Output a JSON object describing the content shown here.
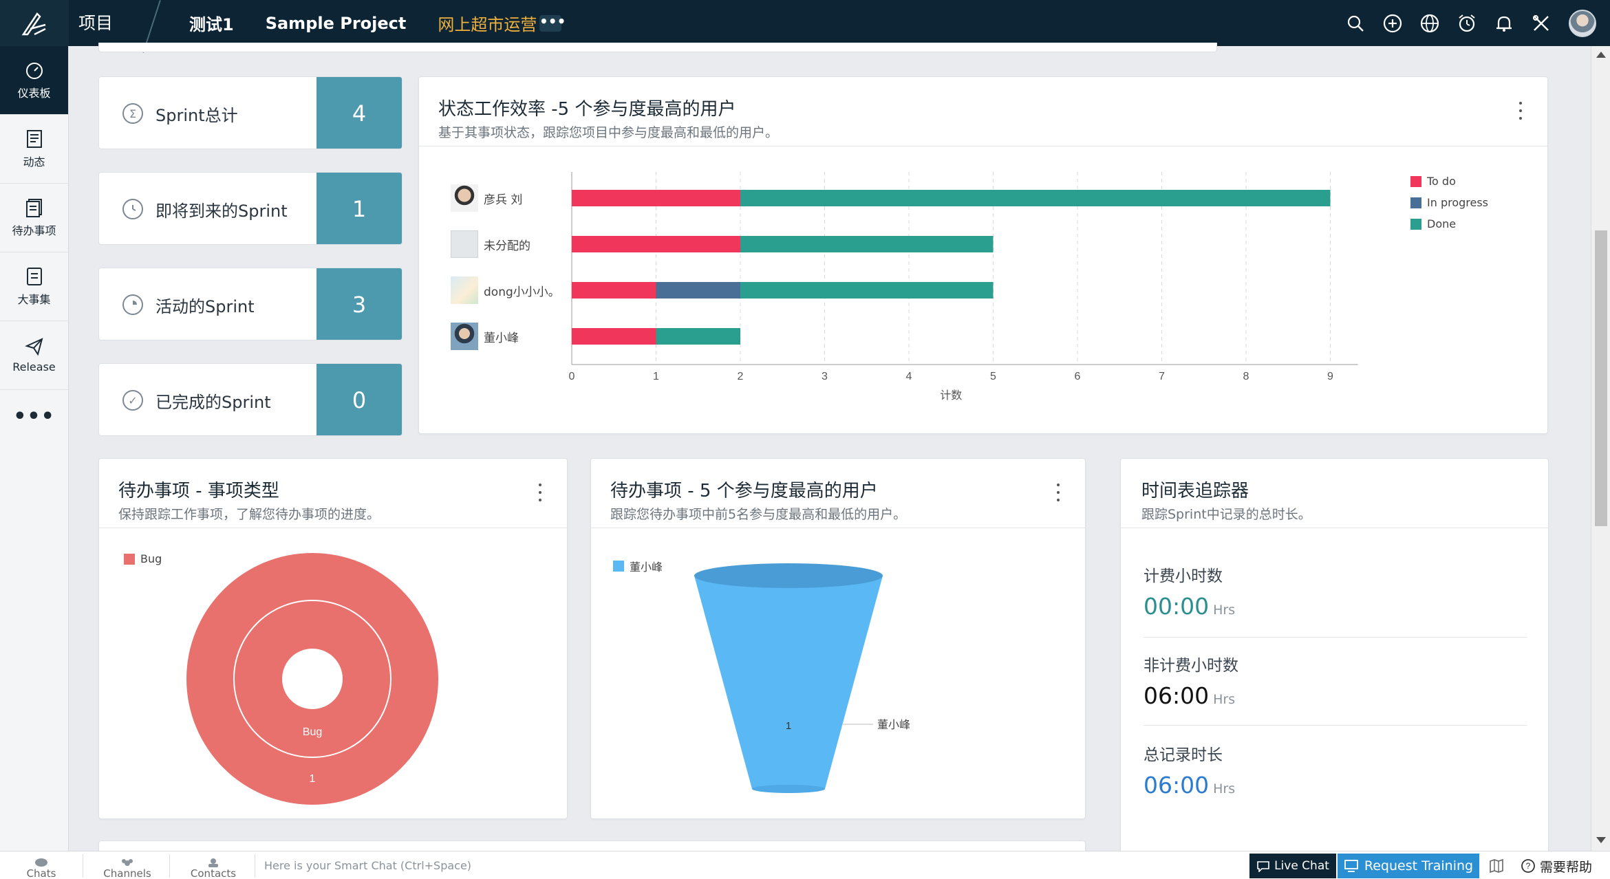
{
  "topbar": {
    "project_label": "项目",
    "tabs": [
      "测试1",
      "Sample Project",
      "网上超市运营"
    ],
    "more": "•••",
    "icons": [
      "search-icon",
      "add-icon",
      "globe-icon",
      "alarm-icon",
      "bell-icon",
      "tools-icon"
    ]
  },
  "leftnav": {
    "items": [
      {
        "label": "仪表板",
        "icon": "dashboard-icon"
      },
      {
        "label": "动态",
        "icon": "feed-icon"
      },
      {
        "label": "待办事项",
        "icon": "backlog-icon"
      },
      {
        "label": "大事集",
        "icon": "epic-icon"
      },
      {
        "label": "Release",
        "icon": "release-icon"
      }
    ],
    "more": "•••"
  },
  "stats": [
    {
      "label": "Sprint总计",
      "value": "4",
      "icon": "sigma-icon"
    },
    {
      "label": "即将到来的Sprint",
      "value": "1",
      "icon": "clock-icon"
    },
    {
      "label": "活动的Sprint",
      "value": "3",
      "icon": "timer-icon"
    },
    {
      "label": "已完成的Sprint",
      "value": "0",
      "icon": "check-circle-icon"
    }
  ],
  "status_chart": {
    "title": "状态工作效率 -5 个参与度最高的用户",
    "subtitle": "基于其事项状态，跟踪您项目中参与度最高和最低的用户。",
    "users": [
      "彦兵 刘",
      "未分配的",
      "dong小小小。",
      "董小峰"
    ],
    "legend": [
      "To do",
      "In progress",
      "Done"
    ]
  },
  "backlog_type": {
    "title": "待办事项 - 事项类型",
    "subtitle": "保持跟踪工作事项，了解您待办事项的进度。",
    "legend": "Bug",
    "inner_label": "Bug",
    "count_label": "1"
  },
  "backlog_users": {
    "title": "待办事项 - 5 个参与度最高的用户",
    "subtitle": "跟踪您待办事项中前5名参与度最高和最低的用户。",
    "legend": "董小峰",
    "funnel_value": "1",
    "funnel_label": "董小峰"
  },
  "timesheet": {
    "title": "时间表追踪器",
    "subtitle": "跟踪Sprint中记录的总时长。",
    "rows": [
      {
        "label": "计费小时数",
        "value": "00:00",
        "unit": "Hrs",
        "color": "#2b8f8f"
      },
      {
        "label": "非计费小时数",
        "value": "06:00",
        "unit": "Hrs",
        "color": "#111111"
      },
      {
        "label": "总记录时长",
        "value": "06:00",
        "unit": "Hrs",
        "color": "#2b7bd0"
      }
    ]
  },
  "bottombar": {
    "chats": "Chats",
    "channels": "Channels",
    "contacts": "Contacts",
    "smartchat_placeholder": "Here is your Smart Chat (Ctrl+Space)",
    "livechat": "Live Chat",
    "request_training": "Request Training",
    "need_help": "需要帮助"
  },
  "colors": {
    "todo": "#f0365b",
    "in_progress": "#4a6f96",
    "done": "#2a9e8f",
    "bug": "#e8716e",
    "funnel": "#5ab8f5",
    "stat_box": "#4d9aaf"
  },
  "chart_data": [
    {
      "type": "bar",
      "orientation": "horizontal",
      "stacked": true,
      "categories": [
        "彦兵 刘",
        "未分配的",
        "dong小小小。",
        "董小峰"
      ],
      "series": [
        {
          "name": "To do",
          "values": [
            2,
            2,
            1,
            1
          ]
        },
        {
          "name": "In progress",
          "values": [
            0,
            0,
            1,
            0
          ]
        },
        {
          "name": "Done",
          "values": [
            7,
            3,
            3,
            1
          ]
        }
      ],
      "xlabel": "计数",
      "xlim": [
        0,
        9
      ],
      "xticks": [
        "0",
        "1",
        "2",
        "3",
        "4",
        "5",
        "6",
        "7",
        "8",
        "9"
      ],
      "legend_position": "top-right",
      "grid": true
    },
    {
      "type": "pie",
      "variant": "donut",
      "categories": [
        "Bug"
      ],
      "values": [
        1
      ],
      "legend_position": "top-left"
    },
    {
      "type": "funnel",
      "categories": [
        "董小峰"
      ],
      "values": [
        1
      ],
      "legend_position": "top-left"
    }
  ]
}
